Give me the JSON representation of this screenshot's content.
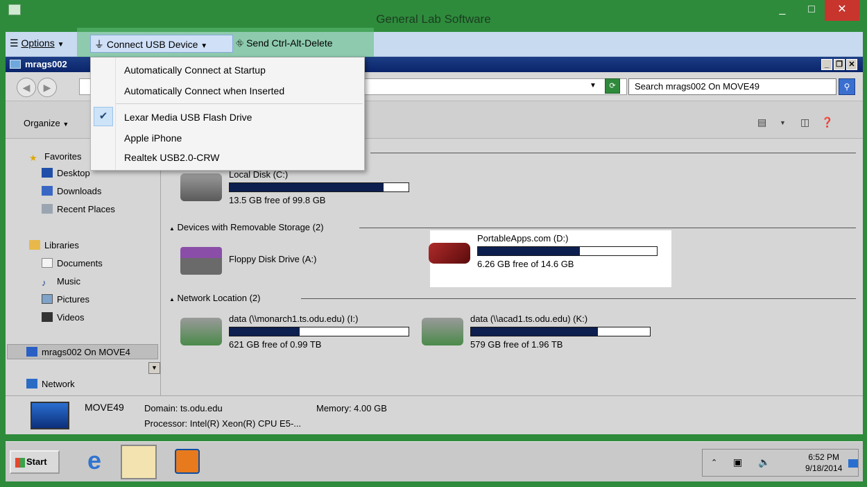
{
  "window": {
    "title": "General Lab Software",
    "minimize": "_",
    "maximize": "□",
    "close": "✕"
  },
  "toolbar": {
    "options": "Options",
    "connect_usb": "Connect USB Device",
    "send_cad": "Send Ctrl-Alt-Delete"
  },
  "usb_menu": {
    "items": [
      "Automatically Connect at Startup",
      "Automatically Connect when Inserted",
      "Lexar Media USB Flash Drive",
      "Apple iPhone",
      "Realtek USB2.0-CRW"
    ],
    "checked_item": "Lexar Media USB Flash Drive"
  },
  "explorer": {
    "title": "mrags002",
    "search_placeholder": "Search mrags002 On MOVE49",
    "organize": "Organize"
  },
  "nav": {
    "favorites": "Favorites",
    "desktop": "Desktop",
    "downloads": "Downloads",
    "recent_places": "Recent Places",
    "libraries": "Libraries",
    "documents": "Documents",
    "music": "Music",
    "pictures": "Pictures",
    "videos": "Videos",
    "computer": "mrags002 On MOVE4",
    "network": "Network"
  },
  "groups": {
    "removable": "Devices with Removable Storage (2)",
    "network": "Network Location (2)"
  },
  "drives": {
    "c": {
      "name": "Local Disk (C:)",
      "free": "13.5 GB free of 99.8 GB",
      "used_fraction": 0.86
    },
    "a": {
      "name": "Floppy Disk Drive (A:)"
    },
    "d": {
      "name": "PortableApps.com (D:)",
      "free": "6.26 GB free of 14.6 GB",
      "used_fraction": 0.57
    },
    "i": {
      "name": "data (\\\\monarch1.ts.odu.edu) (I:)",
      "free": "621 GB free of 0.99 TB",
      "used_fraction": 0.39
    },
    "k": {
      "name": "data (\\\\acad1.ts.odu.edu) (K:)",
      "free": "579 GB free of 1.96 TB",
      "used_fraction": 0.71
    }
  },
  "details": {
    "computer": "MOVE49",
    "domain": "Domain: ts.odu.edu",
    "memory": "Memory: 4.00 GB",
    "processor": "Processor: Intel(R) Xeon(R) CPU E5-..."
  },
  "taskbar": {
    "start": "Start",
    "time": "6:52 PM",
    "date": "9/18/2014"
  },
  "colors": {
    "accent": "#2e8b3c",
    "menu_highlight": "#cde3f7",
    "drive_bar_fill": "#0d1f4f"
  }
}
